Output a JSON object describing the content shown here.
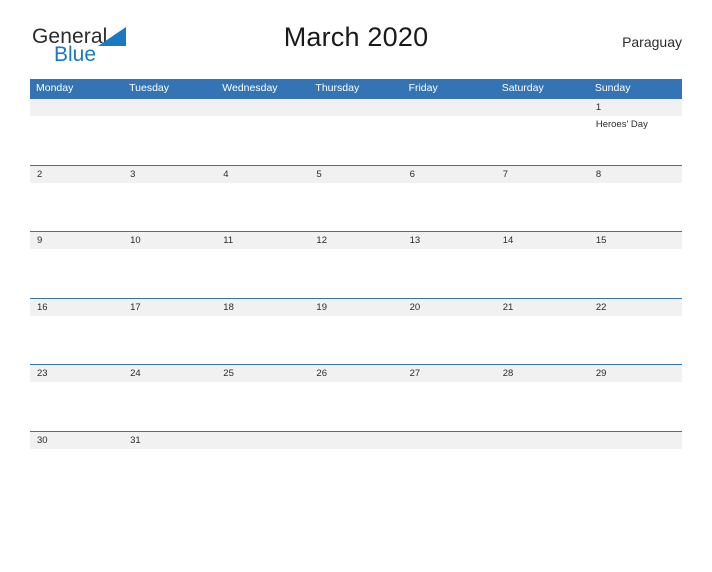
{
  "brand": {
    "word_one": "General",
    "word_two": "Blue",
    "flag_icon": "blue-triangle-flag-icon",
    "accent_color": "#1b79c3"
  },
  "header": {
    "title": "March 2020",
    "region": "Paraguay"
  },
  "colors": {
    "header_blue": "#3474b4",
    "row_divider_blue": "#3474b4",
    "number_band_gray": "#f1f1f1",
    "text_dark": "#2b2b2b",
    "background": "#ffffff"
  },
  "calendar": {
    "month": "March",
    "year": "2020",
    "weekday_headers": [
      "Monday",
      "Tuesday",
      "Wednesday",
      "Thursday",
      "Friday",
      "Saturday",
      "Sunday"
    ],
    "weeks": [
      {
        "days": [
          {
            "number": "",
            "event": ""
          },
          {
            "number": "",
            "event": ""
          },
          {
            "number": "",
            "event": ""
          },
          {
            "number": "",
            "event": ""
          },
          {
            "number": "",
            "event": ""
          },
          {
            "number": "",
            "event": ""
          },
          {
            "number": "1",
            "event": "Heroes' Day"
          }
        ]
      },
      {
        "days": [
          {
            "number": "2",
            "event": ""
          },
          {
            "number": "3",
            "event": ""
          },
          {
            "number": "4",
            "event": ""
          },
          {
            "number": "5",
            "event": ""
          },
          {
            "number": "6",
            "event": ""
          },
          {
            "number": "7",
            "event": ""
          },
          {
            "number": "8",
            "event": ""
          }
        ]
      },
      {
        "days": [
          {
            "number": "9",
            "event": ""
          },
          {
            "number": "10",
            "event": ""
          },
          {
            "number": "11",
            "event": ""
          },
          {
            "number": "12",
            "event": ""
          },
          {
            "number": "13",
            "event": ""
          },
          {
            "number": "14",
            "event": ""
          },
          {
            "number": "15",
            "event": ""
          }
        ]
      },
      {
        "days": [
          {
            "number": "16",
            "event": ""
          },
          {
            "number": "17",
            "event": ""
          },
          {
            "number": "18",
            "event": ""
          },
          {
            "number": "19",
            "event": ""
          },
          {
            "number": "20",
            "event": ""
          },
          {
            "number": "21",
            "event": ""
          },
          {
            "number": "22",
            "event": ""
          }
        ]
      },
      {
        "days": [
          {
            "number": "23",
            "event": ""
          },
          {
            "number": "24",
            "event": ""
          },
          {
            "number": "25",
            "event": ""
          },
          {
            "number": "26",
            "event": ""
          },
          {
            "number": "27",
            "event": ""
          },
          {
            "number": "28",
            "event": ""
          },
          {
            "number": "29",
            "event": ""
          }
        ]
      },
      {
        "days": [
          {
            "number": "30",
            "event": ""
          },
          {
            "number": "31",
            "event": ""
          },
          {
            "number": "",
            "event": ""
          },
          {
            "number": "",
            "event": ""
          },
          {
            "number": "",
            "event": ""
          },
          {
            "number": "",
            "event": ""
          },
          {
            "number": "",
            "event": ""
          }
        ]
      }
    ]
  }
}
